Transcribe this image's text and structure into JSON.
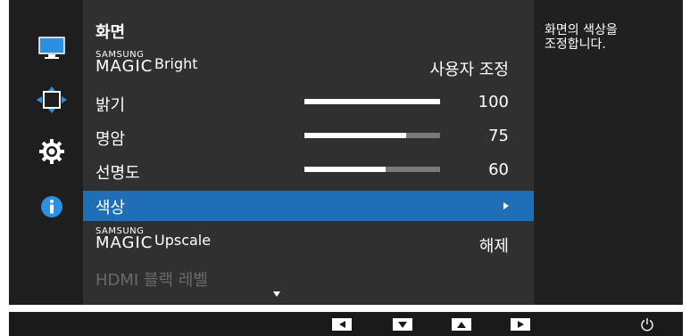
{
  "menu": {
    "title": "화면",
    "items": [
      {
        "brand_small": "SAMSUNG",
        "brand_big": "MAGIC",
        "label": "Bright",
        "value": "사용자 조정"
      },
      {
        "label": "밝기",
        "value": "100",
        "level": 100
      },
      {
        "label": "명암",
        "value": "75",
        "level": 75
      },
      {
        "label": "선명도",
        "value": "60",
        "level": 60
      },
      {
        "label": "색상",
        "selected": true
      },
      {
        "brand_small": "SAMSUNG",
        "brand_big": "MAGIC",
        "label": "Upscale",
        "value": "해제"
      },
      {
        "label": "HDMI 블랙 레벨",
        "disabled": true
      }
    ]
  },
  "description": "화면의 색상을\n조정합니다.",
  "left_icons": [
    "monitor-icon",
    "position-icon",
    "settings-gear-icon",
    "info-icon"
  ],
  "bottom_buttons": [
    "left-arrow-icon",
    "down-arrow-icon",
    "up-arrow-icon",
    "right-arrow-icon",
    "power-icon"
  ],
  "colors": {
    "selected": "#1f6fb6",
    "panel": "#303030",
    "background": "#1e1e1e"
  }
}
